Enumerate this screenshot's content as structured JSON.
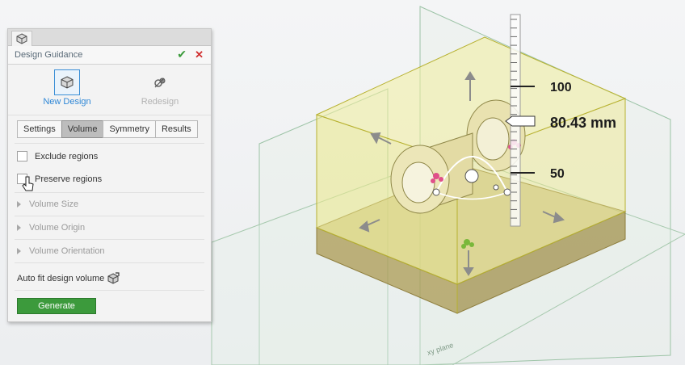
{
  "panel": {
    "title": "Design Guidance",
    "modes": [
      {
        "label": "New Design",
        "icon": "cube-icon",
        "state": "active"
      },
      {
        "label": "Redesign",
        "icon": "redesign-icon",
        "state": "disabled"
      }
    ],
    "tabs": [
      {
        "label": "Settings",
        "selected": false
      },
      {
        "label": "Volume",
        "selected": true
      },
      {
        "label": "Symmetry",
        "selected": false
      },
      {
        "label": "Results",
        "selected": false
      }
    ],
    "checks": [
      {
        "label": "Exclude regions",
        "checked": false
      },
      {
        "label": "Preserve regions",
        "checked": false
      }
    ],
    "sections": [
      {
        "label": "Volume Size"
      },
      {
        "label": "Volume Origin"
      },
      {
        "label": "Volume Orientation"
      }
    ],
    "autofit_label": "Auto fit design volume",
    "generate_label": "Generate"
  },
  "viewport": {
    "ruler": {
      "tick_upper": "100",
      "tick_lower": "50",
      "value": "80.43 mm"
    },
    "plane_label": "xy plane",
    "colors": {
      "design_volume": "#ece98a",
      "base_block": "#b7a55e",
      "accent": "#2f87d6",
      "generate": "#3c9a3c"
    }
  }
}
